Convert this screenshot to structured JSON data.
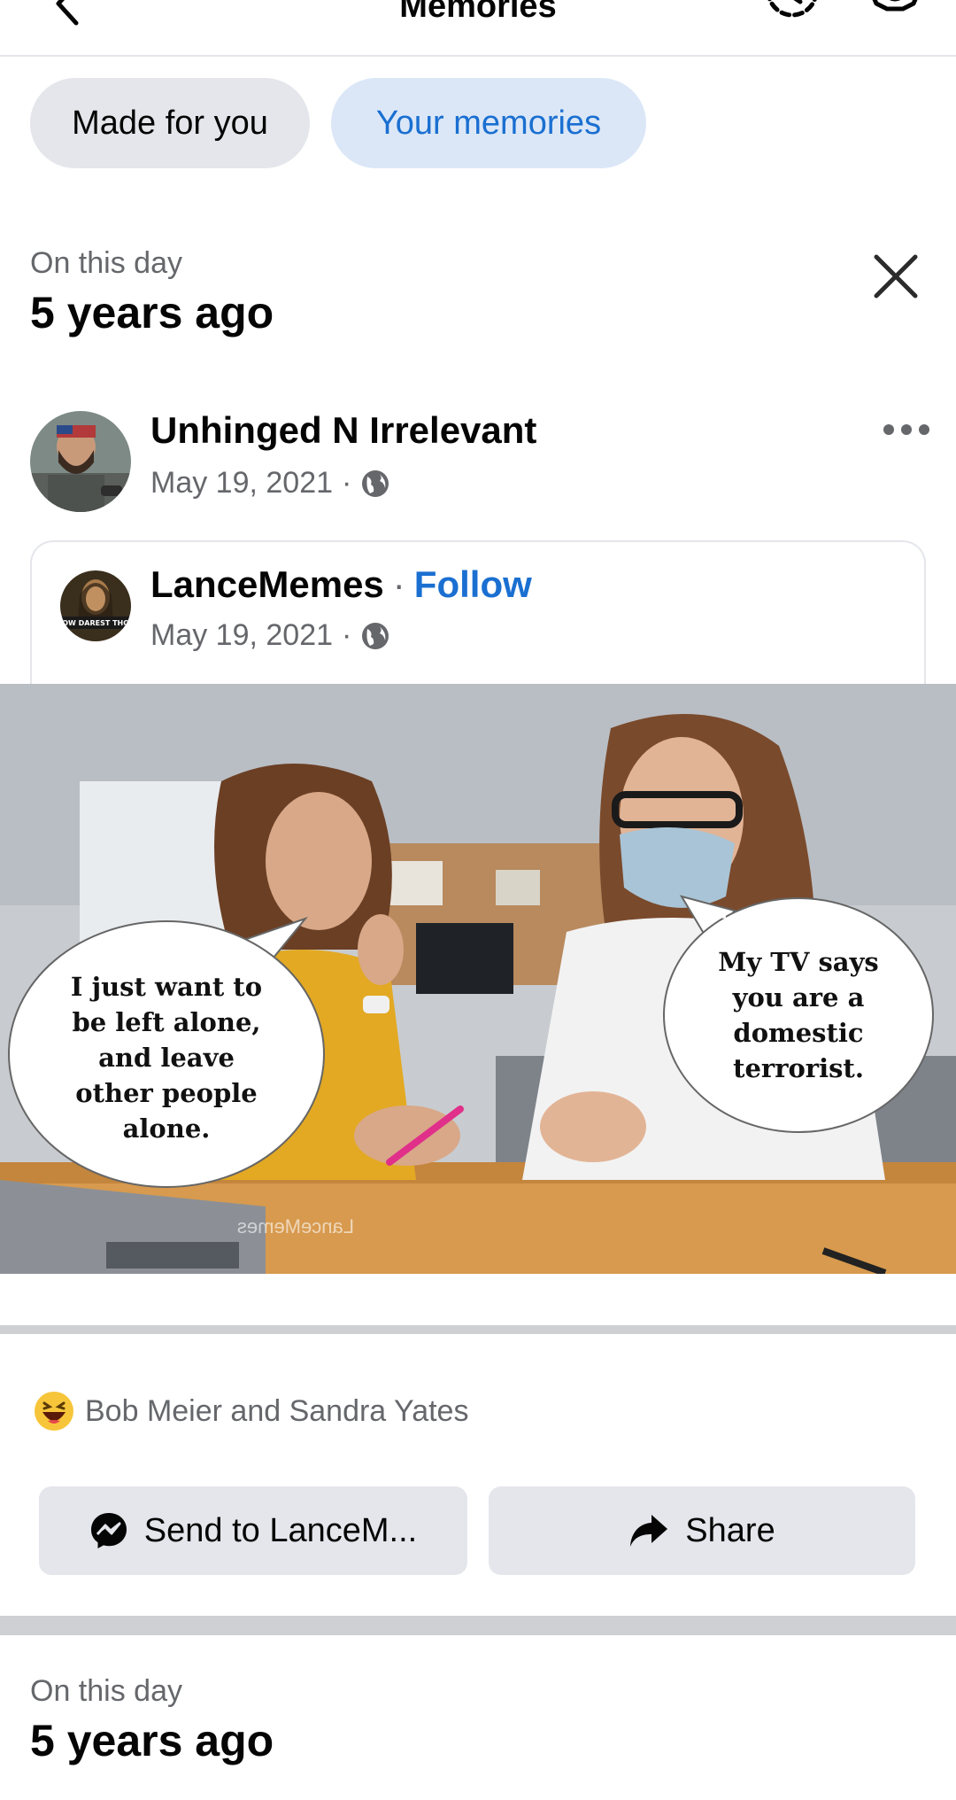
{
  "header": {
    "title": "Memories"
  },
  "tabs": [
    {
      "label": "Made for you",
      "selected": false
    },
    {
      "label": "Your memories",
      "selected": true
    }
  ],
  "memory1": {
    "label": "On this day",
    "time_ago": "5 years ago",
    "post": {
      "author": "Unhinged N Irrelevant",
      "date": "May 19, 2021",
      "separator": "·",
      "shared": {
        "author": "LanceMemes",
        "separator": "·",
        "follow_label": "Follow",
        "date": "May 19, 2021",
        "avatar_text": "HOW DAREST THOU",
        "image": {
          "left_bubble": [
            "I just want to",
            "be left alone,",
            "and leave",
            "other people",
            "alone."
          ],
          "right_bubble": [
            "My TV says",
            "you are a",
            "domestic",
            "terrorist."
          ],
          "watermark": "LanceMemes"
        }
      },
      "reactions_text": "Bob Meier and Sandra Yates",
      "actions": {
        "send_label": "Send to LanceM...",
        "share_label": "Share"
      }
    }
  },
  "memory2": {
    "label": "On this day",
    "time_ago": "5 years ago"
  },
  "colors": {
    "accent": "#1a6fd1",
    "pill_selected_bg": "#dbe7f7",
    "button_bg": "#e4e6eb",
    "muted_text": "#65676b"
  }
}
